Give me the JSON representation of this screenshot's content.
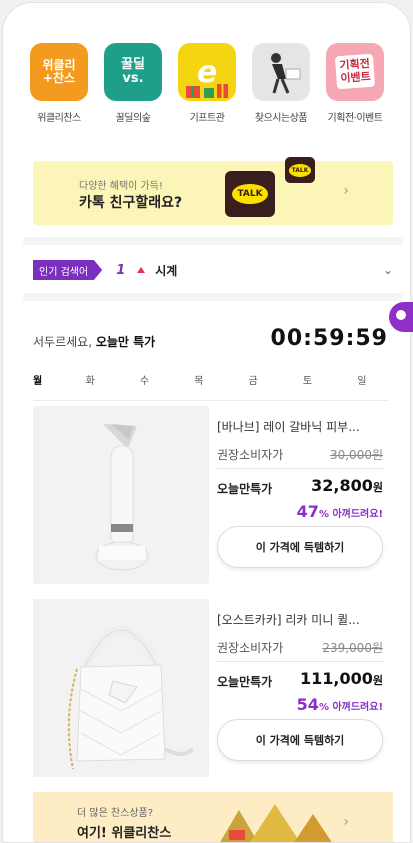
{
  "categories": [
    {
      "label": "위클리찬스",
      "tile_text": "위클리\n+찬스",
      "color": "#f39a1f"
    },
    {
      "label": "꿀딜의숲",
      "tile_text": "꿀딜\nvs.",
      "color": "#1f9e8a"
    },
    {
      "label": "기프트관",
      "tile_text": "e",
      "color": "#f5d512"
    },
    {
      "label": "찾으시는상품",
      "tile_text": "",
      "color": "#d9d9d9"
    },
    {
      "label": "기획전·이벤트",
      "tile_text": "기획전\n이벤트",
      "color": "#f6a7b4"
    }
  ],
  "kakao_banner": {
    "small_text": "다양한 혜택이 가득!",
    "big_text": "카톡 친구할래요?",
    "talk_label": "TALK",
    "talk_label_small": "TALK",
    "arrow": "›"
  },
  "popular_search": {
    "tag": "인기 검색어",
    "rank": "1",
    "keyword": "시계",
    "expand_icon": "⌄"
  },
  "deal": {
    "title_prefix": "서두르세요,",
    "title_bold": "오늘만 특가",
    "timer": "00:59:59",
    "days": [
      "월",
      "화",
      "수",
      "목",
      "금",
      "토",
      "일"
    ]
  },
  "products": [
    {
      "name": "[바나브] 레이 갈바닉 피부...",
      "retail_label": "권장소비자가",
      "retail_price": "30,000원",
      "today_label": "오늘만특가",
      "today_price": "32,800",
      "won": "원",
      "discount_pct": "47",
      "discount_text": "% 아껴드려요!",
      "button": "이 가격에 득템하기"
    },
    {
      "name": "[오스트카카] 리카 미니 퀼...",
      "retail_label": "권장소비자가",
      "retail_price": "239,000원",
      "today_label": "오늘만특가",
      "today_price": "111,000",
      "won": "원",
      "discount_pct": "54",
      "discount_text": "% 아껴드려요!",
      "button": "이 가격에 득템하기"
    }
  ],
  "bottom_banner": {
    "small_text": "더 많은 찬스상품?",
    "big_text": "여기! 위클리찬스",
    "arrow": "›"
  }
}
